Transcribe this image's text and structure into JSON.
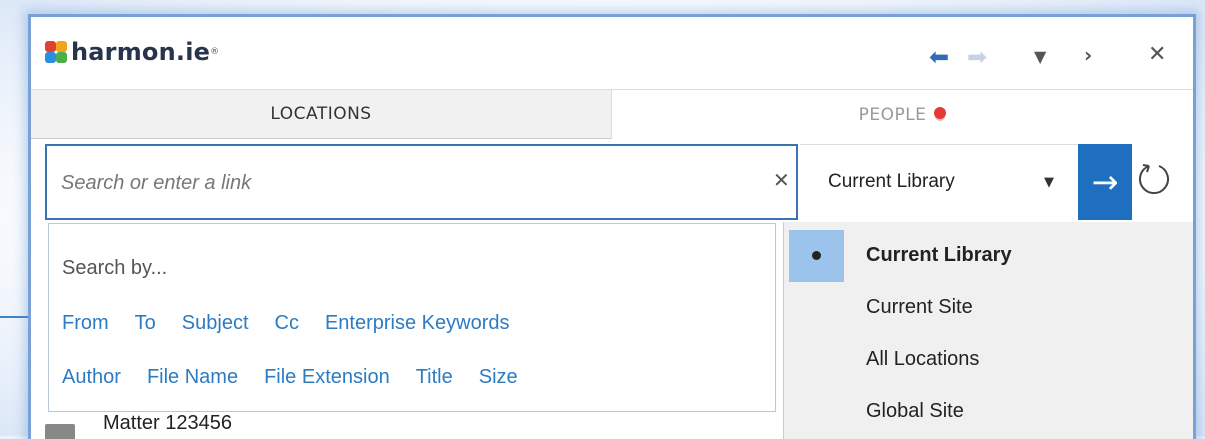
{
  "app": {
    "brand_name": "harmon.ie",
    "brand_mark": "®",
    "logo_colors": [
      "#e2412f",
      "#f2a51b",
      "#2d8de0",
      "#4cae48"
    ]
  },
  "titlebar": {
    "back_icon": "arrow-left-icon",
    "forward_icon": "arrow-right-icon",
    "menu_icon": "triangle-down-icon",
    "collapse_icon": "chevron-right-icon",
    "close_icon": "close-icon"
  },
  "tabs": [
    {
      "label": "LOCATIONS",
      "active": true
    },
    {
      "label": "PEOPLE",
      "active": false,
      "status_color": "#e53935"
    }
  ],
  "search": {
    "placeholder": "Search or enter a link",
    "value": "",
    "clear_icon": "close-icon",
    "scope_selected": "Current Library",
    "go_icon": "arrow-right-icon",
    "refresh_icon": "refresh-icon",
    "accent_color": "#1f6fc1"
  },
  "search_by": {
    "title": "Search by...",
    "row1": [
      "From",
      "To",
      "Subject",
      "Cc",
      "Enterprise Keywords"
    ],
    "row2": [
      "Author",
      "File Name",
      "File Extension",
      "Title",
      "Size"
    ],
    "link_color": "#2d7bc2"
  },
  "scope_options": [
    {
      "label": "Current Library",
      "selected": true
    },
    {
      "label": "Current Site",
      "selected": false
    },
    {
      "label": "All Locations",
      "selected": false
    },
    {
      "label": "Global Site",
      "selected": false
    }
  ],
  "list": {
    "partial_item": "Matter 123456"
  }
}
